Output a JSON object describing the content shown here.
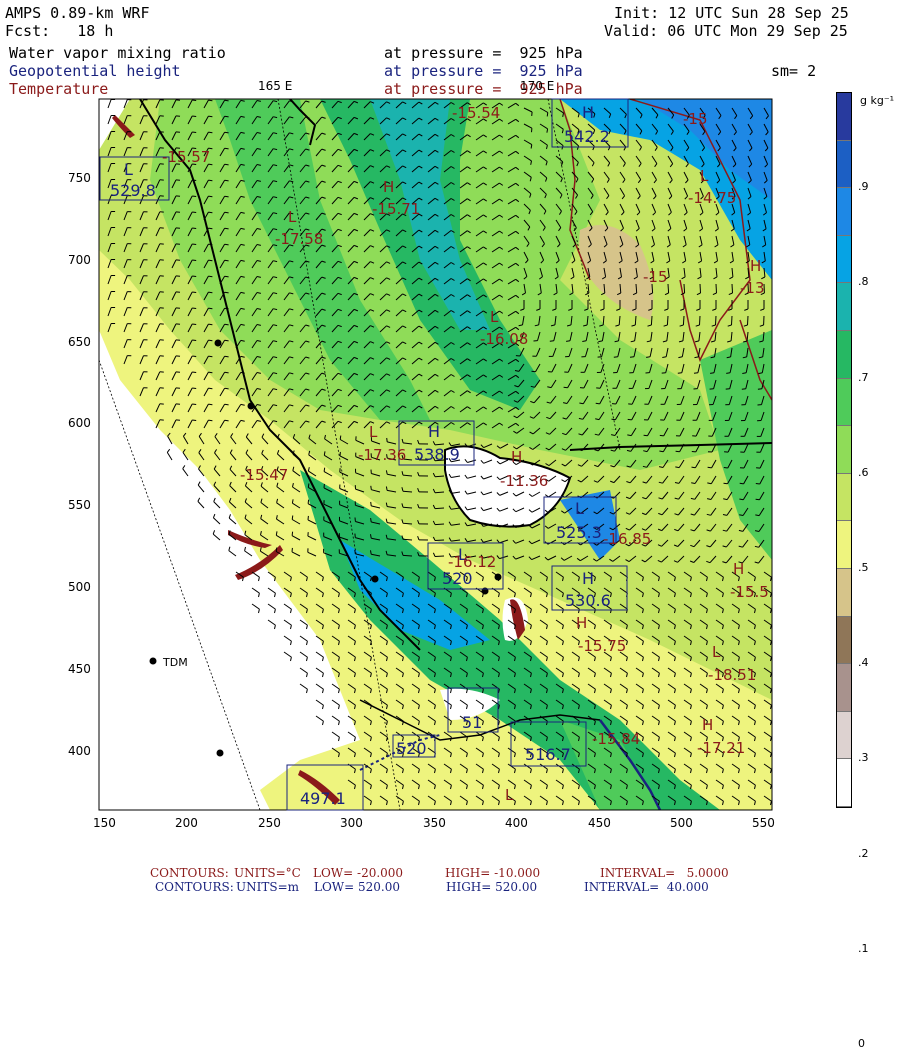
{
  "header": {
    "model": "AMPS 0.89-km WRF",
    "forecast": "Fcst:   18 h",
    "init": "Init: 12 UTC Sun 28 Sep 25",
    "valid": "Valid: 06 UTC Mon 29 Sep 25",
    "field1_name": "Water vapor mixing ratio",
    "field1_level": "at pressure =  925 hPa",
    "field2_name": "Geopotential height",
    "field2_level": "at pressure =  925 hPa",
    "smoothing": "sm= 2",
    "field3_name": "Temperature",
    "field3_level": "at pressure =  925 hPa"
  },
  "map": {
    "longitude_labels": [
      "165 E",
      "170 E"
    ],
    "x_ticks": [
      "150",
      "200",
      "250",
      "300",
      "350",
      "400",
      "450",
      "500",
      "550"
    ],
    "y_ticks": [
      "750",
      "700",
      "650",
      "600",
      "550",
      "500",
      "450",
      "400"
    ],
    "station_label": "TDM",
    "height_labels": [
      {
        "type": "L",
        "value": "529.8"
      },
      {
        "type": "H",
        "value": "542.2"
      },
      {
        "type": "H",
        "value": "538.9"
      },
      {
        "type": "L",
        "value": "525.3"
      },
      {
        "type": "L",
        "value": "520"
      },
      {
        "type": "H",
        "value": "530.6"
      },
      {
        "type": "",
        "value": "516.7"
      },
      {
        "type": "",
        "value": "520"
      },
      {
        "type": "",
        "value": "497.1"
      },
      {
        "type": "",
        "value": "51"
      }
    ],
    "temp_labels": [
      {
        "type": "",
        "value": "-15.54"
      },
      {
        "type": "",
        "value": "-15"
      },
      {
        "type": "",
        "value": "-15.57"
      },
      {
        "type": "H",
        "value": "-15.71"
      },
      {
        "type": "L",
        "value": "-17.58"
      },
      {
        "type": "L",
        "value": "-14.75"
      },
      {
        "type": "",
        "value": "-15"
      },
      {
        "type": "H",
        "value": "-13"
      },
      {
        "type": "L",
        "value": "-16.08"
      },
      {
        "type": "L",
        "value": "-17.36"
      },
      {
        "type": "",
        "value": "-15.47"
      },
      {
        "type": "H",
        "value": "-11.36"
      },
      {
        "type": "",
        "value": "-16.85"
      },
      {
        "type": "",
        "value": "-16.12"
      },
      {
        "type": "H",
        "value": "-15.5"
      },
      {
        "type": "H",
        "value": "-15.75"
      },
      {
        "type": "L",
        "value": "-18.51"
      },
      {
        "type": "",
        "value": "-15.84"
      },
      {
        "type": "H",
        "value": "-17.21"
      },
      {
        "type": "",
        "value": "L"
      }
    ]
  },
  "colorbar": {
    "unit": "g kg⁻¹",
    "labels": [
      ".9",
      ".8",
      ".7",
      ".6",
      ".5",
      ".4",
      ".3",
      ".2",
      ".1",
      "0"
    ],
    "colors": [
      "#283a9e",
      "#1c5fc4",
      "#1e88e5",
      "#06a3e4",
      "#1bb3ae",
      "#26b863",
      "#4fcb5a",
      "#8fdc58",
      "#c5e463",
      "#eef47e",
      "#d6c48a",
      "#8f7658",
      "#a8928d",
      "#ddd2d0",
      "#ffffff"
    ]
  },
  "footer": {
    "line1_label": "CONTOURS:",
    "line1_units": "UNITS=°C",
    "line1_low": "LOW= -20.000",
    "line1_high": "HIGH= -10.000",
    "line1_interval": "INTERVAL=   5.0000",
    "line2_label": "CONTOURS:",
    "line2_units": "UNITS=m",
    "line2_low": "LOW= 520.00",
    "line2_high": "HIGH= 520.00",
    "line2_interval": "INTERVAL=  40.000"
  }
}
